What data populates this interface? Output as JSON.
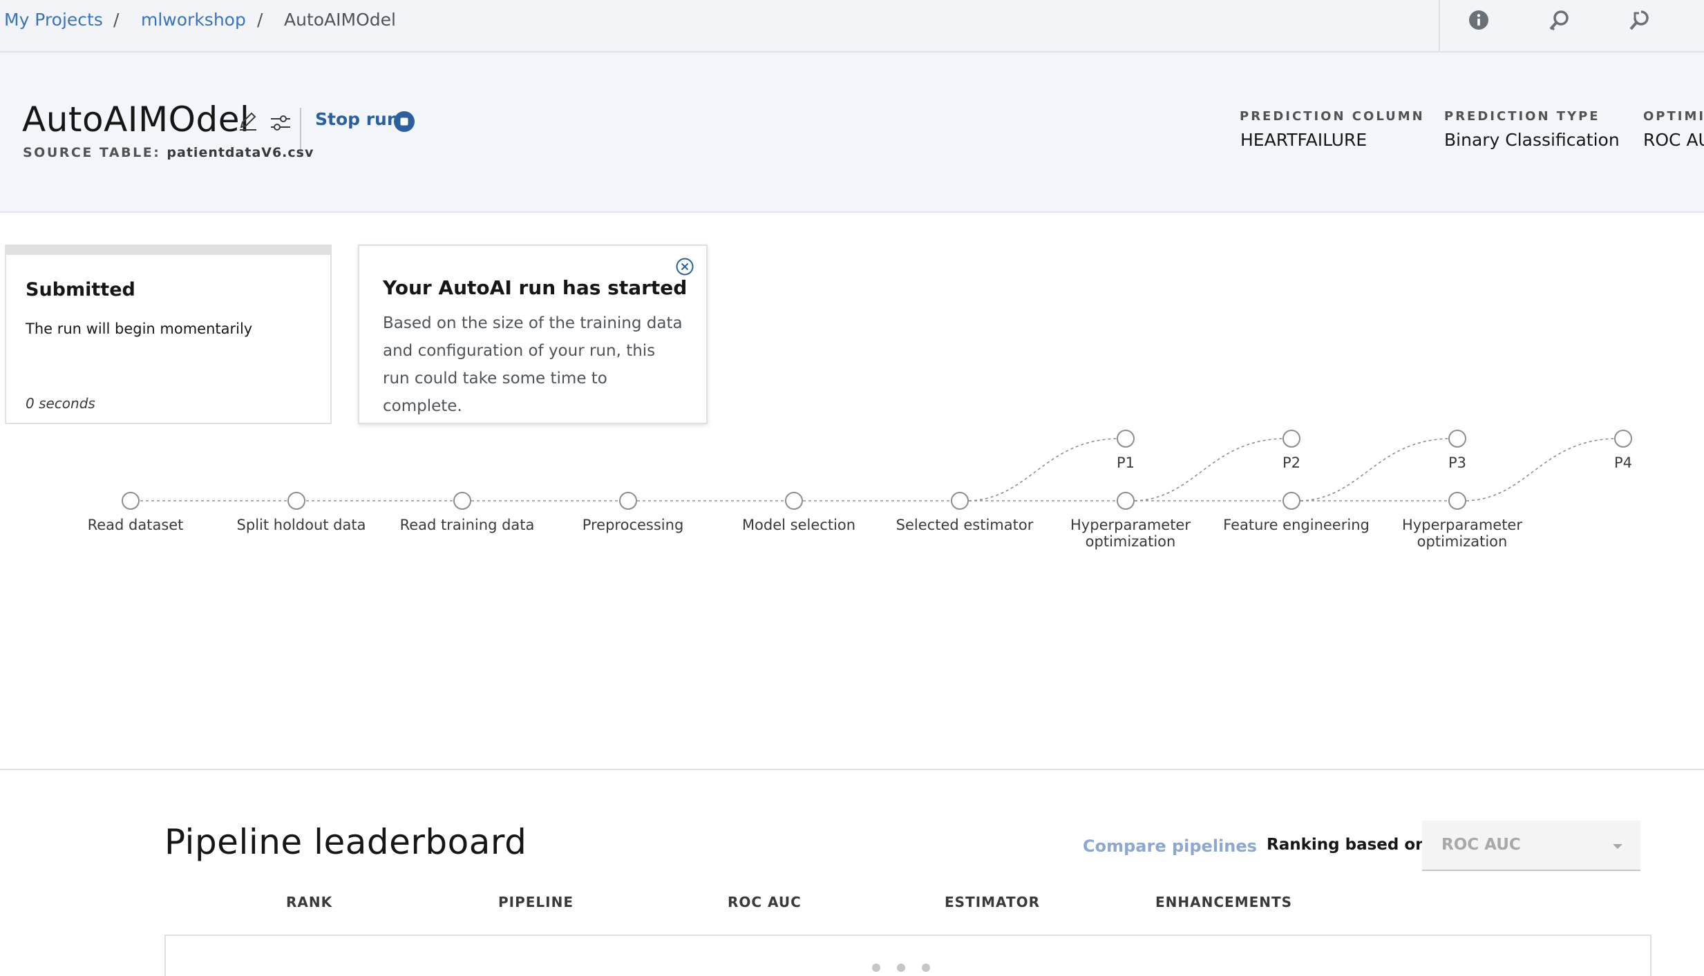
{
  "breadcrumb": {
    "items": [
      {
        "label": "My Projects"
      },
      {
        "label": "mlworkshop"
      },
      {
        "label": "AutoAIMOdel"
      }
    ],
    "separator": "/"
  },
  "top_icons": [
    "info-icon",
    "search-key-icon",
    "search-refresh-icon"
  ],
  "header": {
    "model_name": "AutoAIMOdel",
    "source_label": "SOURCE TABLE:",
    "source_value": "patientdataV6.csv",
    "stop_run_label": "Stop run",
    "meta": [
      {
        "label": "PREDICTION COLUMN",
        "value": "HEARTFAILURE"
      },
      {
        "label": "PREDICTION TYPE",
        "value": "Binary Classification"
      },
      {
        "label": "OPTIMIZ",
        "value": "ROC AU"
      }
    ]
  },
  "status_card": {
    "title": "Submitted",
    "description": "The run will begin momentarily",
    "elapsed": "0 seconds"
  },
  "toast": {
    "title": "Your AutoAI run has started",
    "body": "Based on the size of the training data and configuration of your run, this run could take some time to complete."
  },
  "pipeline": {
    "steps": [
      {
        "label": "Read dataset"
      },
      {
        "label": "Split holdout data"
      },
      {
        "label": "Read training data"
      },
      {
        "label": "Preprocessing"
      },
      {
        "label": "Model selection"
      },
      {
        "label": "Selected estimator"
      },
      {
        "label": "Hyperparameter optimization"
      },
      {
        "label": "Feature engineering"
      },
      {
        "label": "Hyperparameter optimization"
      }
    ],
    "outputs": [
      "P1",
      "P2",
      "P3",
      "P4"
    ]
  },
  "leaderboard": {
    "title": "Pipeline leaderboard",
    "compare_label": "Compare pipelines",
    "ranking_label": "Ranking based on:",
    "ranking_value": "ROC AUC",
    "columns": [
      "RANK",
      "PIPELINE",
      "ROC AUC",
      "ESTIMATOR",
      "ENHANCEMENTS"
    ]
  },
  "colors": {
    "link": "#3b73b9",
    "accent": "#2c5f9e",
    "header_bg": "#f2f6fb",
    "topbar_bg": "#f2f4f8"
  }
}
